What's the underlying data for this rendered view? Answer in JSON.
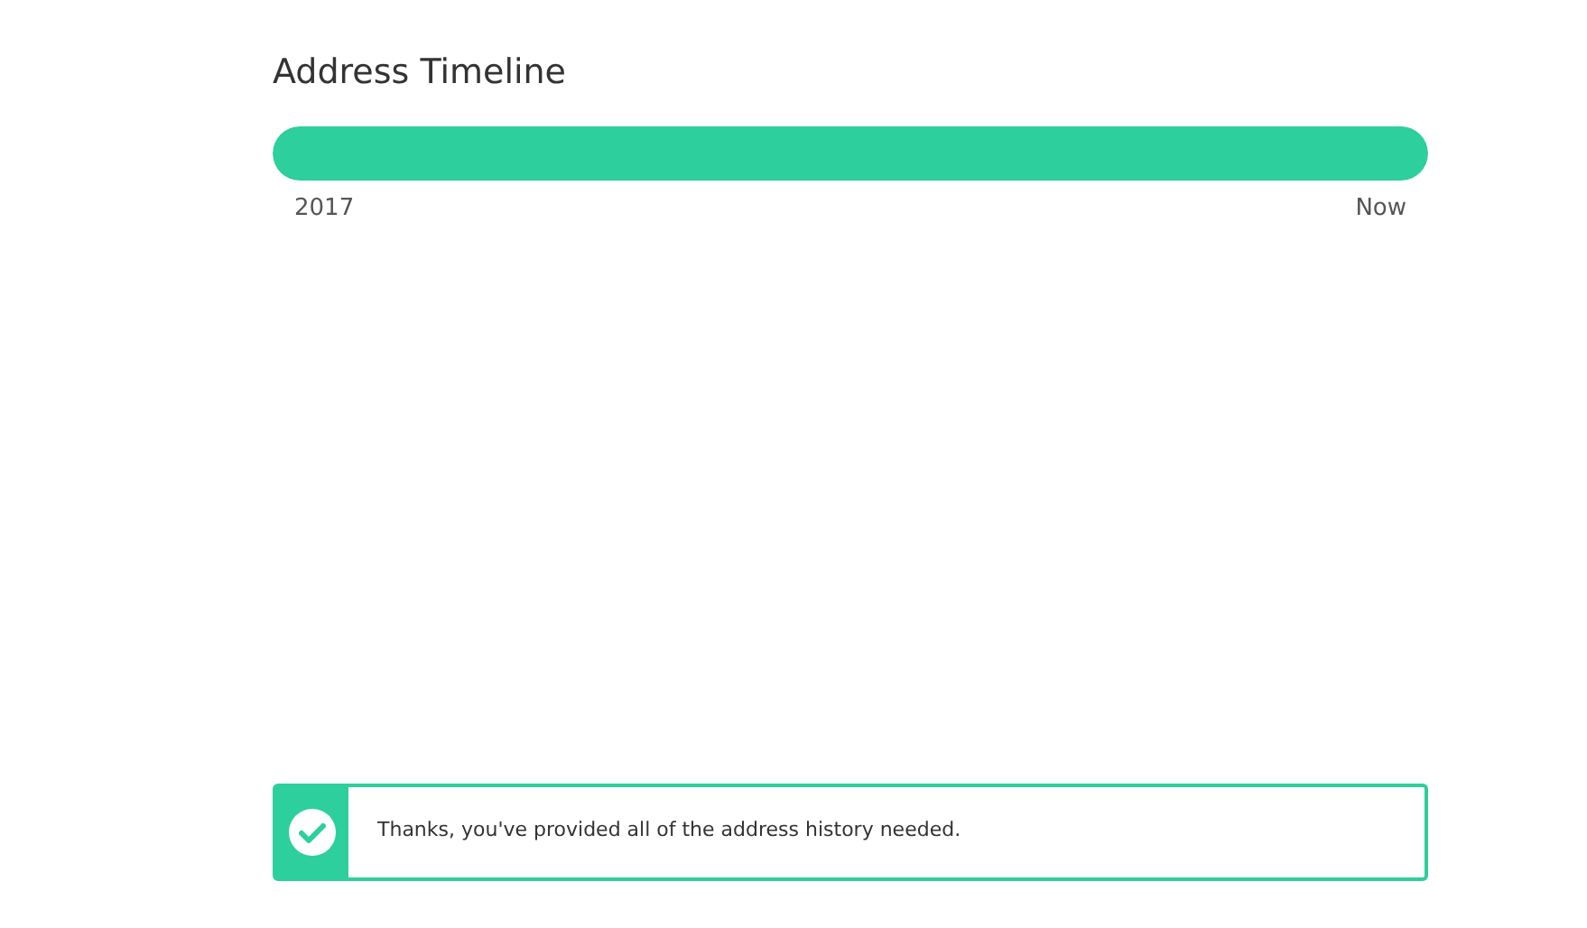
{
  "title": "Address Timeline",
  "timeline": {
    "level": 1,
    "start_label": "2017",
    "end_label": "Now"
  },
  "notice": {
    "kind": "success",
    "message": "Thanks, you've provided all of the address history needed."
  }
}
